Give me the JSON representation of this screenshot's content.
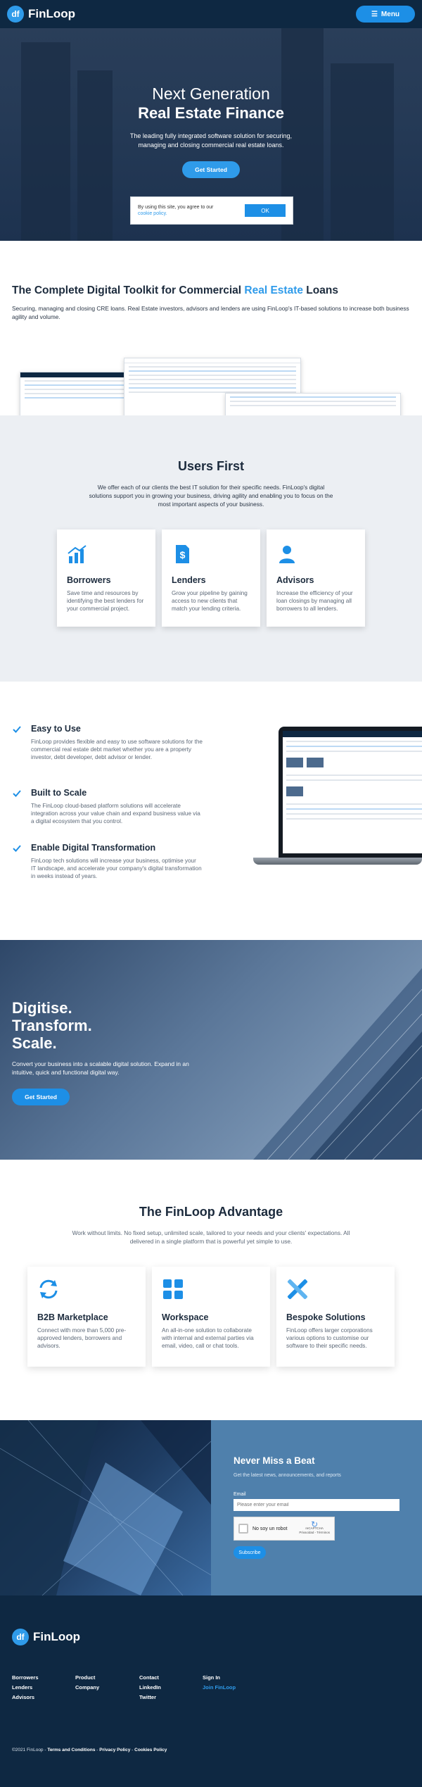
{
  "header": {
    "logo_text": "FinLoop",
    "logo_mark": "df",
    "menu_label": "Menu"
  },
  "hero": {
    "title_line1": "Next Generation",
    "title_line2": "Real Estate Finance",
    "subtitle": "The leading fully integrated software solution for securing, managing and closing commercial real estate loans.",
    "cta": "Get Started"
  },
  "cookie": {
    "text": "By using this site, you agree to our",
    "link": "cookie policy.",
    "ok": "OK"
  },
  "toolkit": {
    "title_before": "The Complete Digital Toolkit for Commercial ",
    "title_highlight": "Real Estate",
    "title_after": " Loans",
    "subtitle": "Securing, managing and closing CRE loans. Real Estate investors, advisors and lenders are using FinLoop's IT-based solutions to increase both business agility and volume."
  },
  "users_first": {
    "title": "Users First",
    "subtitle": "We offer each of our clients the best IT solution for their specific needs. FinLoop's digital solutions support you in growing your business, driving agility and enabling you to focus on the most important aspects of your business.",
    "cards": [
      {
        "icon": "growth-chart-icon",
        "title": "Borrowers",
        "text": "Save time and resources by identifying the best lenders for your commercial project."
      },
      {
        "icon": "dollar-document-icon",
        "title": "Lenders",
        "text": "Grow your pipeline by gaining access to new clients that match your lending criteria."
      },
      {
        "icon": "user-icon",
        "title": "Advisors",
        "text": "Increase the efficiency of your loan closings by managing all borrowers to all lenders."
      }
    ]
  },
  "features": [
    {
      "title": "Easy to Use",
      "text": "FinLoop provides flexible and easy to use software solutions for the commercial real estate debt market whether you are a property investor, debt developer, debt advisor or lender."
    },
    {
      "title": "Built to Scale",
      "text": "The FinLoop cloud-based platform solutions will accelerate integration across your value chain and expand business value via a digital ecosystem that you control."
    },
    {
      "title": "Enable Digital Transformation",
      "text": "FinLoop tech solutions will increase your business, optimise your IT landscape, and accelerate your company's digital transformation in weeks instead of years."
    }
  ],
  "digitise": {
    "line1": "Digitise.",
    "line2": "Transform.",
    "line3": "Scale.",
    "subtitle": "Convert your business into a scalable digital solution. Expand in an intuitive, quick and functional digital way.",
    "cta": "Get Started"
  },
  "advantage": {
    "title": "The FinLoop Advantage",
    "subtitle": "Work without limits. No fixed setup, unlimited scale, tailored to your needs and your clients' expectations. All delivered in a single platform that is powerful yet simple to use.",
    "cards": [
      {
        "icon": "sync-arrows-icon",
        "title": "B2B Marketplace",
        "text": "Connect with more than 5,000 pre-approved lenders, borrowers and advisors."
      },
      {
        "icon": "grid-squares-icon",
        "title": "Workspace",
        "text": "An all-in-one solution to collaborate with internal and external parties via email, video, call or chat tools."
      },
      {
        "icon": "tools-icon",
        "title": "Bespoke Solutions",
        "text": "FinLoop offers larger corporations various options to customise our software to their specific needs."
      }
    ]
  },
  "newsletter": {
    "title": "Never Miss a Beat",
    "subtitle": "Get the latest news, announcements, and reports",
    "email_label": "Email",
    "email_placeholder": "Please enter your email",
    "captcha_label": "No soy un robot",
    "captcha_brand": "reCAPTCHA",
    "captcha_terms": "Privacidad - Términos",
    "subscribe": "Subscribe"
  },
  "footer": {
    "logo_text": "FinLoop",
    "col1": [
      "Borrowers",
      "Lenders",
      "Advisors"
    ],
    "col2": [
      "Product",
      "Company"
    ],
    "col3": [
      "Contact",
      "LinkedIn",
      "Twitter"
    ],
    "col4": [
      "Sign In",
      "Join FinLoop"
    ],
    "copyright": "©2021 FinLoop - ",
    "terms": "Terms and Conditions",
    "privacy": "Privacy Policy",
    "cookies": "Cookies Policy",
    "sep": " - "
  },
  "colors": {
    "accent": "#2f9bea",
    "navy": "#0e2842"
  }
}
